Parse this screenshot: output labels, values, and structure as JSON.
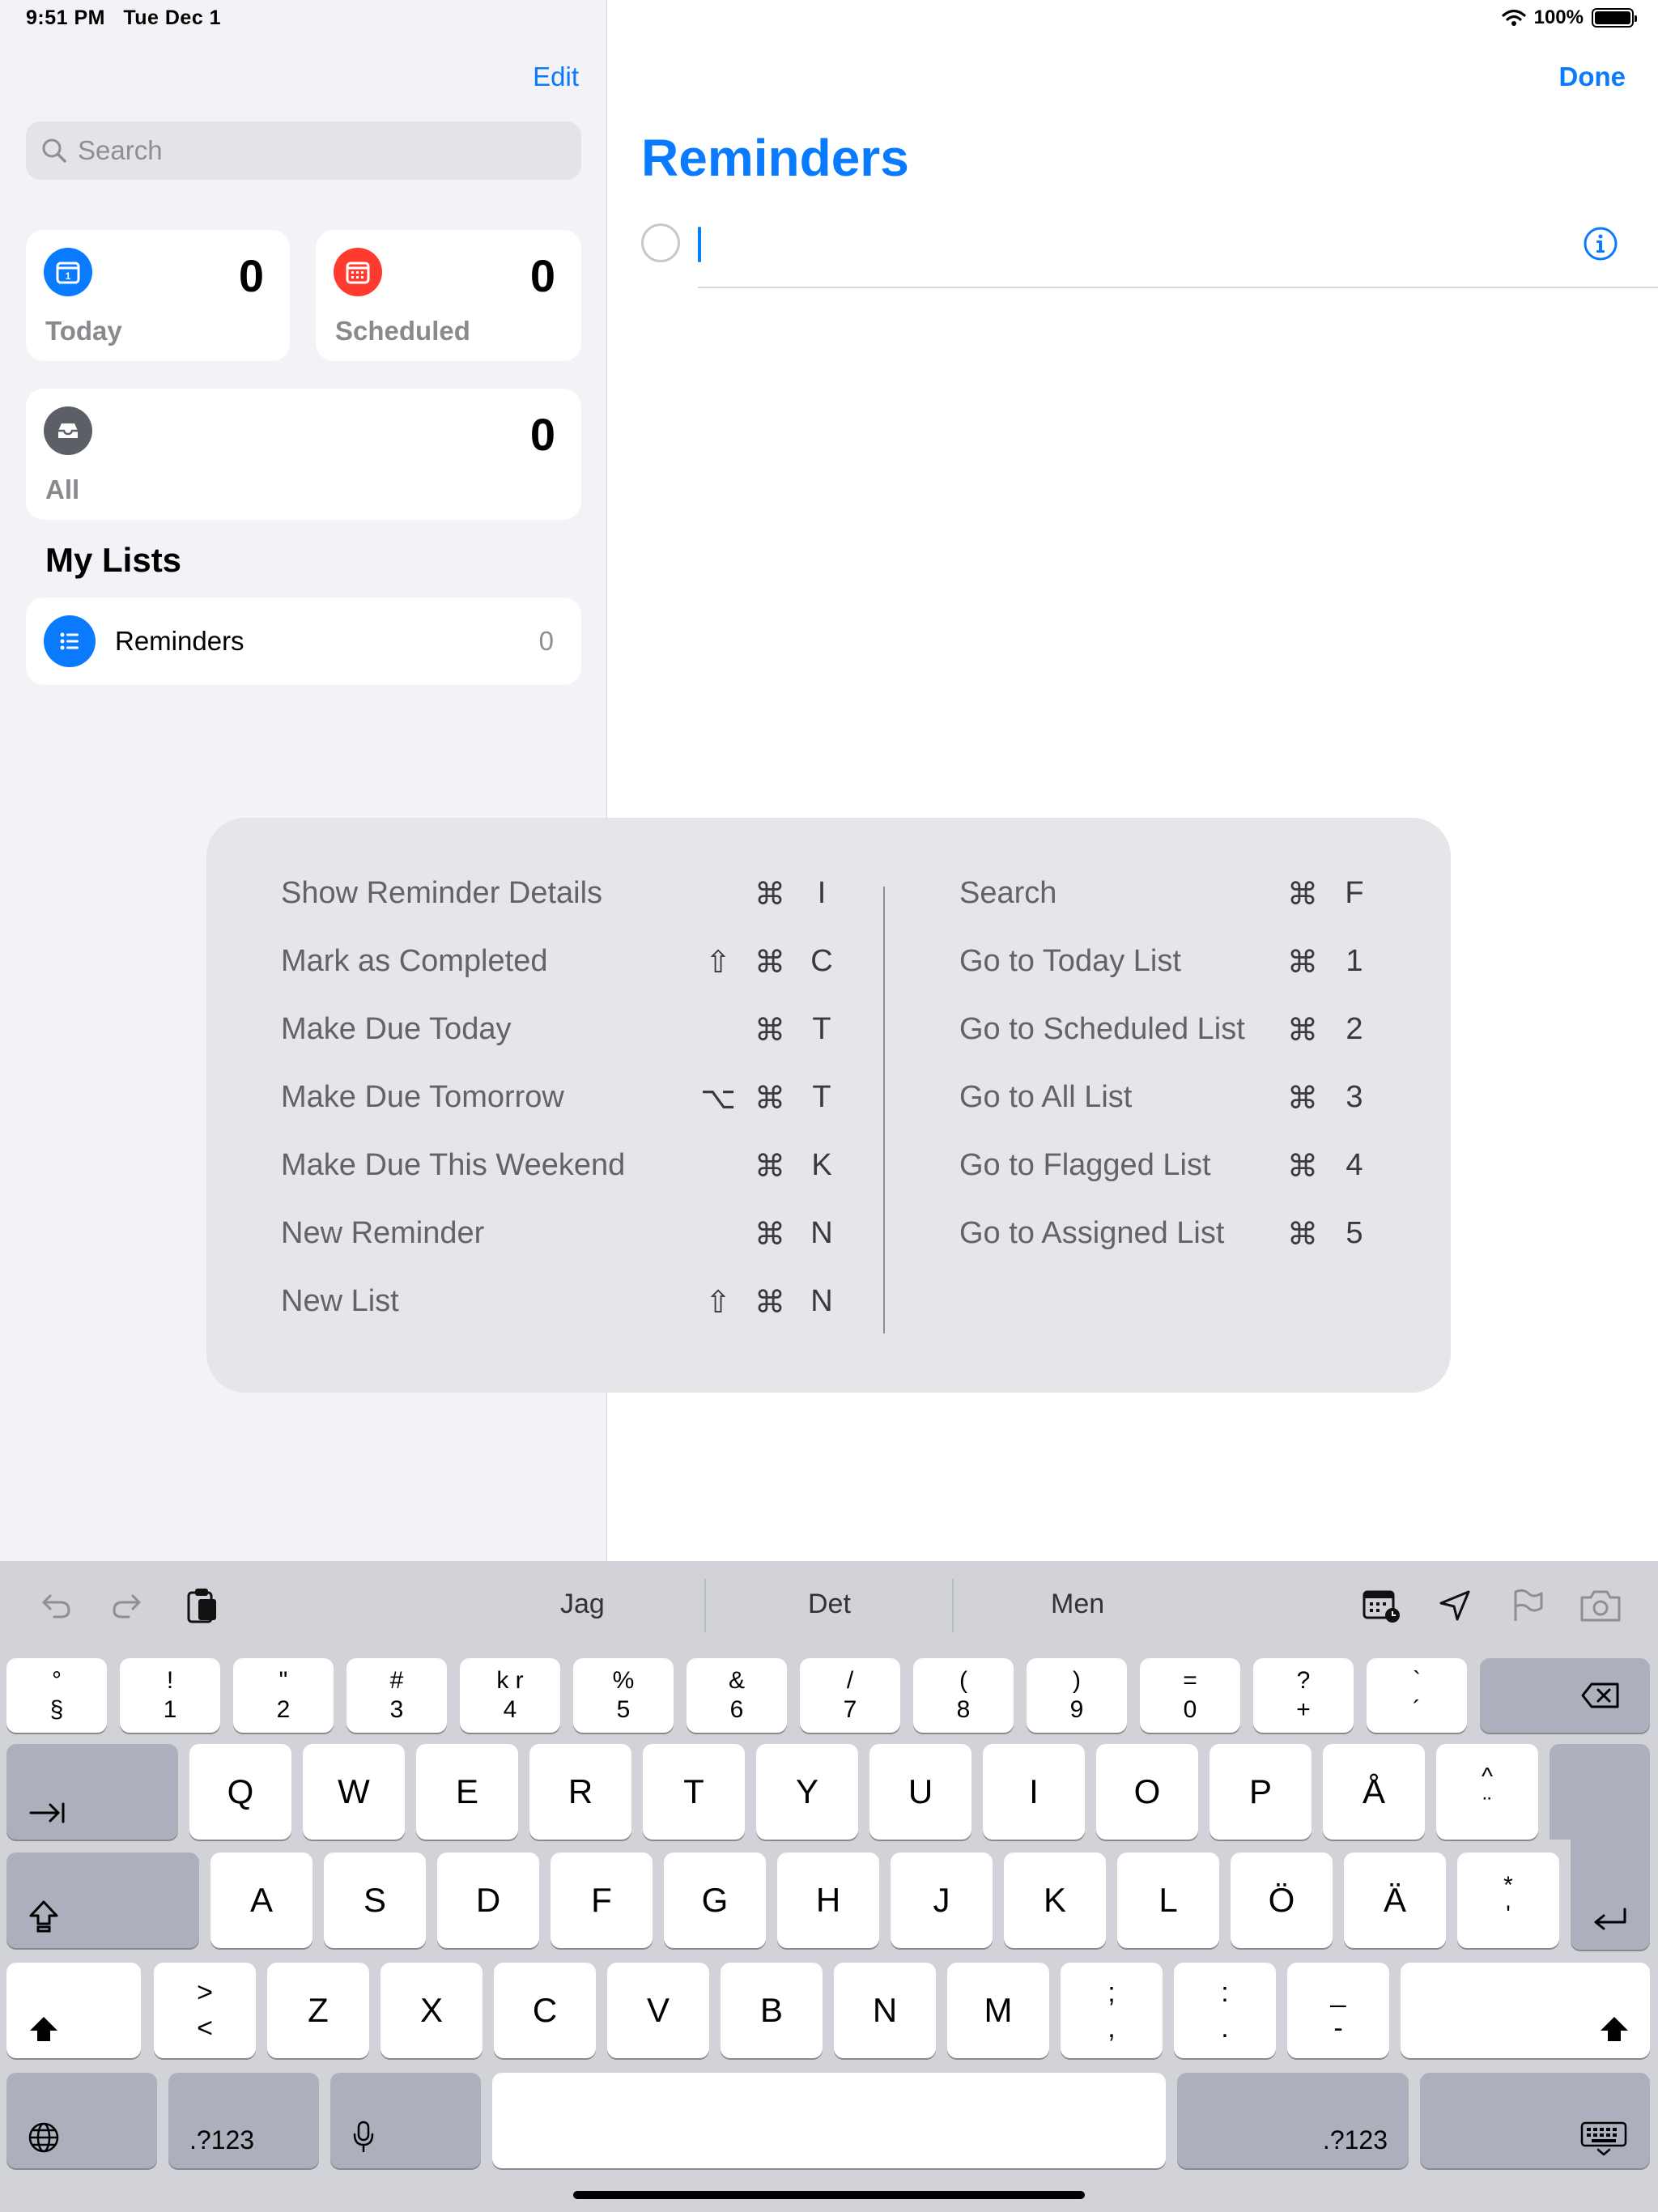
{
  "status": {
    "time": "9:51 PM",
    "date": "Tue Dec 1",
    "battery": "100%"
  },
  "sidebar": {
    "edit": "Edit",
    "search_placeholder": "Search",
    "smart_lists": [
      {
        "label": "Today",
        "count": "0",
        "color": "#0a7aff",
        "icon": "calendar-today-icon"
      },
      {
        "label": "Scheduled",
        "count": "0",
        "color": "#ff3b30",
        "icon": "calendar-grid-icon"
      },
      {
        "label": "All",
        "count": "0",
        "color": "#5c6066",
        "icon": "tray-icon"
      }
    ],
    "my_lists_title": "My Lists",
    "lists": [
      {
        "name": "Reminders",
        "count": "0",
        "color": "#0a7aff"
      }
    ]
  },
  "main": {
    "done": "Done",
    "title": "Reminders",
    "accent": "#0a7aff"
  },
  "shortcuts": {
    "left": [
      {
        "name": "Show Reminder Details",
        "keys": [
          "⌘",
          "I"
        ]
      },
      {
        "name": "Mark as Completed",
        "keys": [
          "⇧",
          "⌘",
          "C"
        ]
      },
      {
        "name": "Make Due Today",
        "keys": [
          "⌘",
          "T"
        ]
      },
      {
        "name": "Make Due Tomorrow",
        "keys": [
          "⌥",
          "⌘",
          "T"
        ]
      },
      {
        "name": "Make Due This Weekend",
        "keys": [
          "⌘",
          "K"
        ]
      },
      {
        "name": "New Reminder",
        "keys": [
          "⌘",
          "N"
        ]
      },
      {
        "name": "New List",
        "keys": [
          "⇧",
          "⌘",
          "N"
        ]
      }
    ],
    "right": [
      {
        "name": "Search",
        "keys": [
          "⌘",
          "F"
        ]
      },
      {
        "name": "Go to Today List",
        "keys": [
          "⌘",
          "1"
        ]
      },
      {
        "name": "Go to Scheduled List",
        "keys": [
          "⌘",
          "2"
        ]
      },
      {
        "name": "Go to All List",
        "keys": [
          "⌘",
          "3"
        ]
      },
      {
        "name": "Go to Flagged List",
        "keys": [
          "⌘",
          "4"
        ]
      },
      {
        "name": "Go to Assigned List",
        "keys": [
          "⌘",
          "5"
        ]
      }
    ]
  },
  "keyboard": {
    "suggestions": [
      "Jag",
      "Det",
      "Men"
    ],
    "toolbar_icons_left": [
      "undo-icon",
      "redo-icon",
      "paste-icon"
    ],
    "toolbar_icons_right": [
      "calendar-icon",
      "location-icon",
      "flag-icon",
      "camera-icon"
    ],
    "number_row": [
      [
        "°",
        "§"
      ],
      [
        "!",
        "1"
      ],
      [
        "\"",
        "2"
      ],
      [
        "#",
        "3"
      ],
      [
        "k r",
        "4"
      ],
      [
        "%",
        "5"
      ],
      [
        "&",
        "6"
      ],
      [
        "/",
        "7"
      ],
      [
        "(",
        "8"
      ],
      [
        ")",
        "9"
      ],
      [
        "=",
        "0"
      ],
      [
        "?",
        "+"
      ],
      [
        "`",
        "´"
      ]
    ],
    "row_q": [
      "Q",
      "W",
      "E",
      "R",
      "T",
      "Y",
      "U",
      "I",
      "O",
      "P",
      "Å"
    ],
    "row_q_last": [
      "^",
      "¨"
    ],
    "row_a": [
      "A",
      "S",
      "D",
      "F",
      "G",
      "H",
      "J",
      "K",
      "L",
      "Ö",
      "Ä"
    ],
    "row_a_last": [
      "*",
      "'"
    ],
    "row_z_first": [
      ">",
      "<"
    ],
    "row_z": [
      "Z",
      "X",
      "C",
      "V",
      "B",
      "N",
      "M"
    ],
    "row_z_punct": [
      [
        ";",
        ","
      ],
      [
        ":",
        "."
      ],
      [
        "_",
        "-"
      ]
    ],
    "numbers_label": ".?123"
  }
}
